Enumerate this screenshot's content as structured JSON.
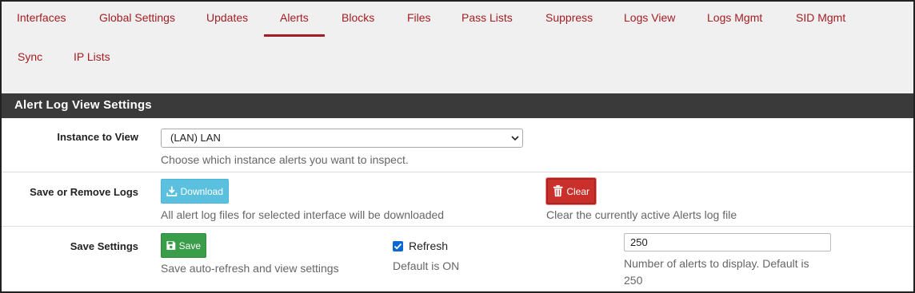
{
  "tabs": [
    {
      "label": "Interfaces"
    },
    {
      "label": "Global Settings"
    },
    {
      "label": "Updates"
    },
    {
      "label": "Alerts",
      "active": true
    },
    {
      "label": "Blocks"
    },
    {
      "label": "Files"
    },
    {
      "label": "Pass Lists"
    },
    {
      "label": "Suppress"
    },
    {
      "label": "Logs View"
    },
    {
      "label": "Logs Mgmt"
    },
    {
      "label": "SID Mgmt"
    },
    {
      "label": "Sync"
    },
    {
      "label": "IP Lists"
    }
  ],
  "panel": {
    "title": "Alert Log View Settings"
  },
  "instance": {
    "label": "Instance to View",
    "selected": "(LAN) LAN",
    "help": "Choose which instance alerts you want to inspect."
  },
  "logs": {
    "label": "Save or Remove Logs",
    "download_label": "Download",
    "download_help": "All alert log files for selected interface will be downloaded",
    "clear_label": "Clear",
    "clear_help": "Clear the currently active Alerts log file"
  },
  "settings": {
    "label": "Save Settings",
    "save_label": "Save",
    "save_help": "Save auto-refresh and view settings",
    "refresh_label": "Refresh",
    "refresh_checked": true,
    "refresh_help": "Default is ON",
    "count_value": "250",
    "count_help_line1": "Number of alerts to display. Default is",
    "count_help_line2": "250"
  },
  "colors": {
    "tab_text": "#a51d22",
    "heading_bg": "#3a3a3a",
    "download_btn": "#5bc0de",
    "clear_btn": "#c9302c",
    "save_btn": "#3a9d4a"
  },
  "icons": {
    "download": "download-icon",
    "clear": "trash-icon",
    "save": "floppy-disk-icon",
    "select": "chevron-down-icon",
    "checkbox": "check-icon"
  }
}
